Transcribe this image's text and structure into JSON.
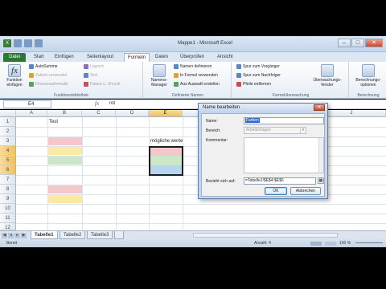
{
  "window": {
    "title": "Mappe1 - Microsoft Excel",
    "min": "–",
    "max": "□",
    "close": "✕"
  },
  "ribbon_tabs": [
    "Datei",
    "Start",
    "Einfügen",
    "Seitenlayout",
    "Formeln",
    "Daten",
    "Überprüfen",
    "Ansicht"
  ],
  "ribbon": {
    "insert_function": "Funktion einfügen",
    "fn_library_items": [
      {
        "label": "AutoSumme",
        "disabled": false
      },
      {
        "label": "Zuletzt verwendet",
        "disabled": true
      },
      {
        "label": "Finanzmathematik",
        "disabled": true
      },
      {
        "label": "Logisch",
        "disabled": true
      },
      {
        "label": "Text",
        "disabled": true
      },
      {
        "label": "Datum u. Uhrzeit",
        "disabled": true
      }
    ],
    "group_fn": "Funktionsbibliothek",
    "name_manager": "Namens-Manager",
    "names_items": [
      "Namen definieren",
      "In Formel verwenden",
      "Aus Auswahl erstellen"
    ],
    "group_names": "Definierte Namen",
    "audit_items": [
      "Spur zum Vorgänger",
      "Spur zum Nachfolger",
      "Pfeile entfernen"
    ],
    "group_audit": "Formelüberwachung",
    "watch": "Überwachungs-fenster",
    "calc_options": "Berechnungs-optionen",
    "group_calc": "Berechnung"
  },
  "formula_bar": {
    "name_box": "E4",
    "fx": "fx",
    "value": "rot"
  },
  "columns": [
    "A",
    "B",
    "C",
    "D",
    "E",
    "F",
    "G",
    "H",
    "I",
    "J"
  ],
  "rows": [
    "1",
    "2",
    "3",
    "4",
    "5",
    "6",
    "7",
    "8",
    "9",
    "10",
    "11",
    "12"
  ],
  "cells": {
    "B1": "Test",
    "E3": "mögliche werte"
  },
  "sheets": [
    "Tabelle1",
    "Tabelle2",
    "Tabelle3"
  ],
  "status": {
    "ready": "Bereit",
    "count": "Anzahl: 4",
    "zoom": "100 %"
  },
  "dialog": {
    "title": "Name bearbeiten",
    "name_label": "Name:",
    "name_value": "Farben",
    "scope_label": "Bereich:",
    "scope_value": "Arbeitsmappe",
    "comment_label": "Kommentar:",
    "refers_label": "Bezieht sich auf:",
    "refers_value": "=Tabelle1!$E$4:$E$6",
    "ok": "OK",
    "cancel": "Abbrechen"
  },
  "colors": {
    "pink": "#f4c7cb",
    "yellow": "#fbe9a4",
    "green": "#cde6c8",
    "blue": "#b7d5ec",
    "excel_green": "#2a7a34"
  }
}
